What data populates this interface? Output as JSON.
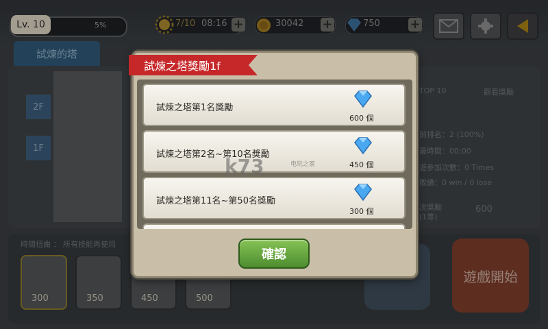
{
  "hud": {
    "level_label": "Lv. 10",
    "exp_percent": "5%",
    "stamina": "7/10",
    "timer": "08:16",
    "coins": "30042",
    "gems": "750",
    "plus": "+"
  },
  "background": {
    "tab_label": "試煉的塔",
    "floors": [
      "2F",
      "1F"
    ],
    "right_panel": {
      "top_button": "TOP 10",
      "view_button": "觀看獎勵",
      "rank_line": "前排名：2 (100%)",
      "time_line": "最時間：00:00",
      "attempts_line": "遊參加次數：0 Times",
      "record_line": "敗績：0 win / 0 lose",
      "reward_line": "次獎勵",
      "reward_sub": "(1等)",
      "reward_amount": "600"
    },
    "skills_caption": "時間扭曲 ： 所有技能再使用",
    "skill_costs": [
      "300",
      "350",
      "450",
      "500"
    ],
    "start_label": "遊戲開始"
  },
  "dialog": {
    "title": "試煉之塔獎勵1f",
    "rewards": [
      {
        "label": "試煉之塔第1名獎勵",
        "amount": "600 個"
      },
      {
        "label": "試煉之塔第2名~第10名獎勵",
        "amount": "450 個"
      },
      {
        "label": "試煉之塔第11名~第50名獎勵",
        "amount": "300 個"
      }
    ],
    "confirm_label": "確認"
  },
  "watermark": {
    "main": "k73",
    "sub": "电玩之家"
  },
  "colors": {
    "ribbon": "#c6282a",
    "confirm": "#5fa13c",
    "gem": "#4aa8f0"
  },
  "icons": [
    "sun-icon",
    "coin-icon",
    "gem-icon",
    "mail-icon",
    "gear-icon",
    "back-arrow-icon"
  ]
}
